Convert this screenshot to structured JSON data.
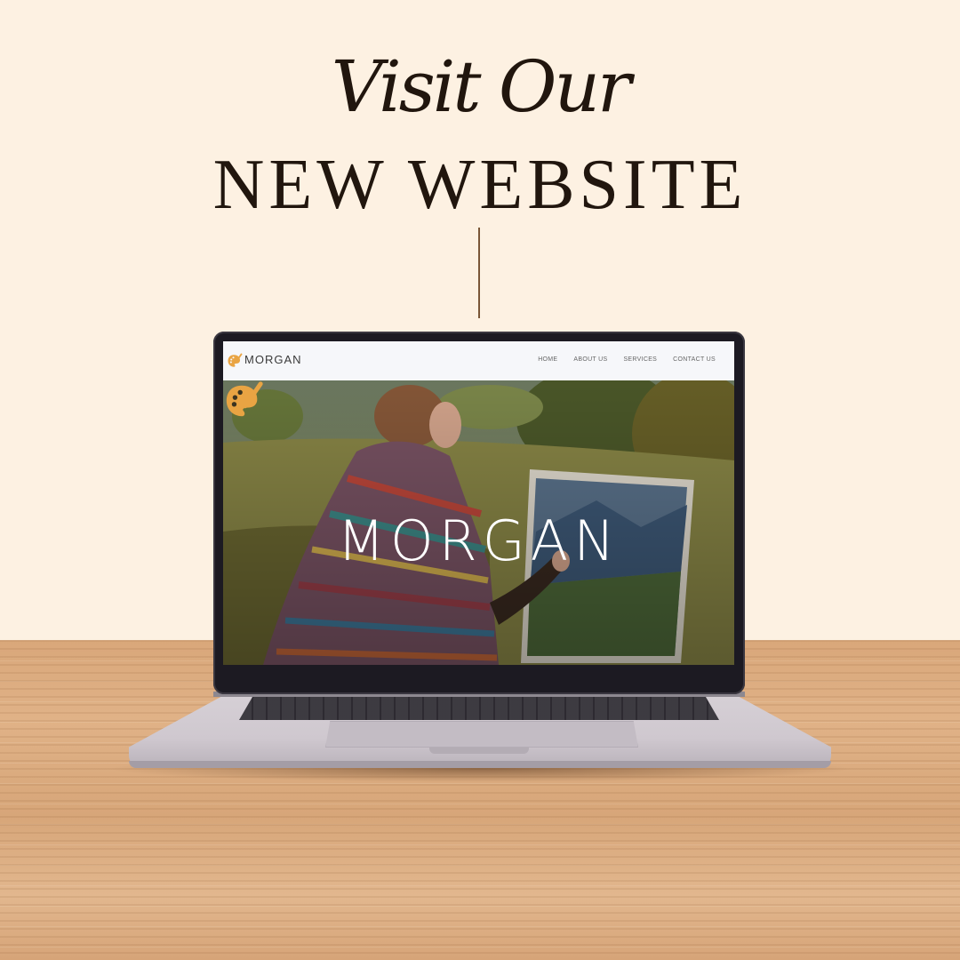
{
  "promo": {
    "script_line": "Visit Our",
    "caps_line": "NEW WEBSITE"
  },
  "website": {
    "nav": {
      "brand": "MORGAN",
      "logo_icon": "palette-brush-icon",
      "links": [
        "HOME",
        "ABOUT US",
        "SERVICES",
        "CONTACT US"
      ]
    },
    "hero": {
      "title": "MORGAN",
      "logo_icon": "palette-brush-icon"
    }
  },
  "colors": {
    "background": "#fdf1e2",
    "headline": "#21160e",
    "accent_orange": "#e9a443",
    "nav_bg": "#f6f7fa"
  }
}
